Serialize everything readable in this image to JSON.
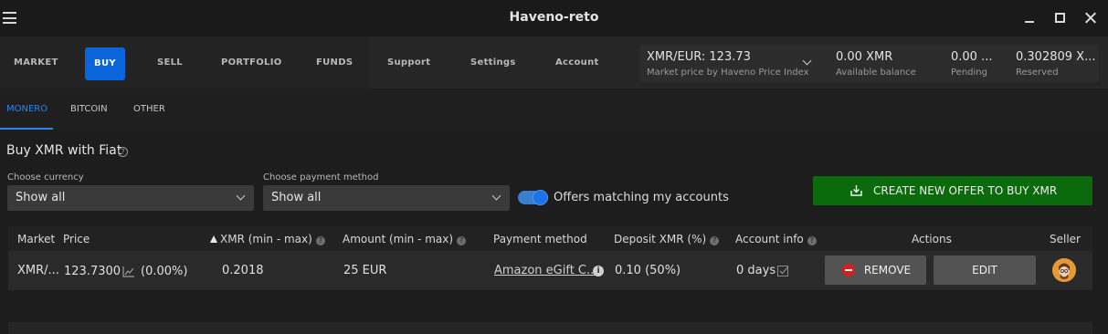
{
  "window": {
    "title": "Haveno-reto"
  },
  "nav": {
    "items": [
      {
        "label": "MARKET"
      },
      {
        "label": "BUY"
      },
      {
        "label": "SELL"
      },
      {
        "label": "PORTFOLIO"
      },
      {
        "label": "FUNDS"
      },
      {
        "label": "Support"
      },
      {
        "label": "Settings"
      },
      {
        "label": "Account"
      }
    ],
    "active": "BUY"
  },
  "balances": {
    "market_price": {
      "value": "XMR/EUR: 123.73",
      "label": "Market price by Haveno Price Index"
    },
    "available": {
      "value": "0.00 XMR",
      "label": "Available balance"
    },
    "pending": {
      "value": "0.00 ...",
      "label": "Pending"
    },
    "reserved": {
      "value": "0.302809 X...",
      "label": "Reserved"
    }
  },
  "subtabs": [
    {
      "label": "MONERO",
      "active": true
    },
    {
      "label": "BITCOIN",
      "active": false
    },
    {
      "label": "OTHER",
      "active": false
    }
  ],
  "page": {
    "heading": "Buy XMR with Fiat",
    "help_glyph": "?",
    "currency_label": "Choose currency",
    "currency_value": "Show all",
    "payment_label": "Choose payment method",
    "payment_value": "Show all",
    "toggle_label": "Offers matching my accounts",
    "toggle_on": true,
    "create_button": "CREATE NEW OFFER TO BUY XMR"
  },
  "table": {
    "headers": {
      "market": "Market",
      "price": "Price",
      "xmr": "XMR (min - max)",
      "amount": "Amount (min - max)",
      "payment": "Payment method",
      "deposit": "Deposit XMR (%)",
      "account": "Account info",
      "actions": "Actions",
      "seller": "Seller"
    },
    "rows": [
      {
        "market": "XMR/...",
        "price": "123.7300",
        "price_change": "(0.00%)",
        "xmr": "0.2018",
        "amount": "25 EUR",
        "payment": "Amazon eGift C...",
        "deposit": "0.10 (50%)",
        "account": "0 days",
        "remove": "REMOVE",
        "edit": "EDIT"
      }
    ]
  },
  "colors": {
    "accent": "#0b65da",
    "create_button": "#0b6a0b",
    "remove_icon": "#d52020",
    "avatar": "#e8a03a"
  }
}
